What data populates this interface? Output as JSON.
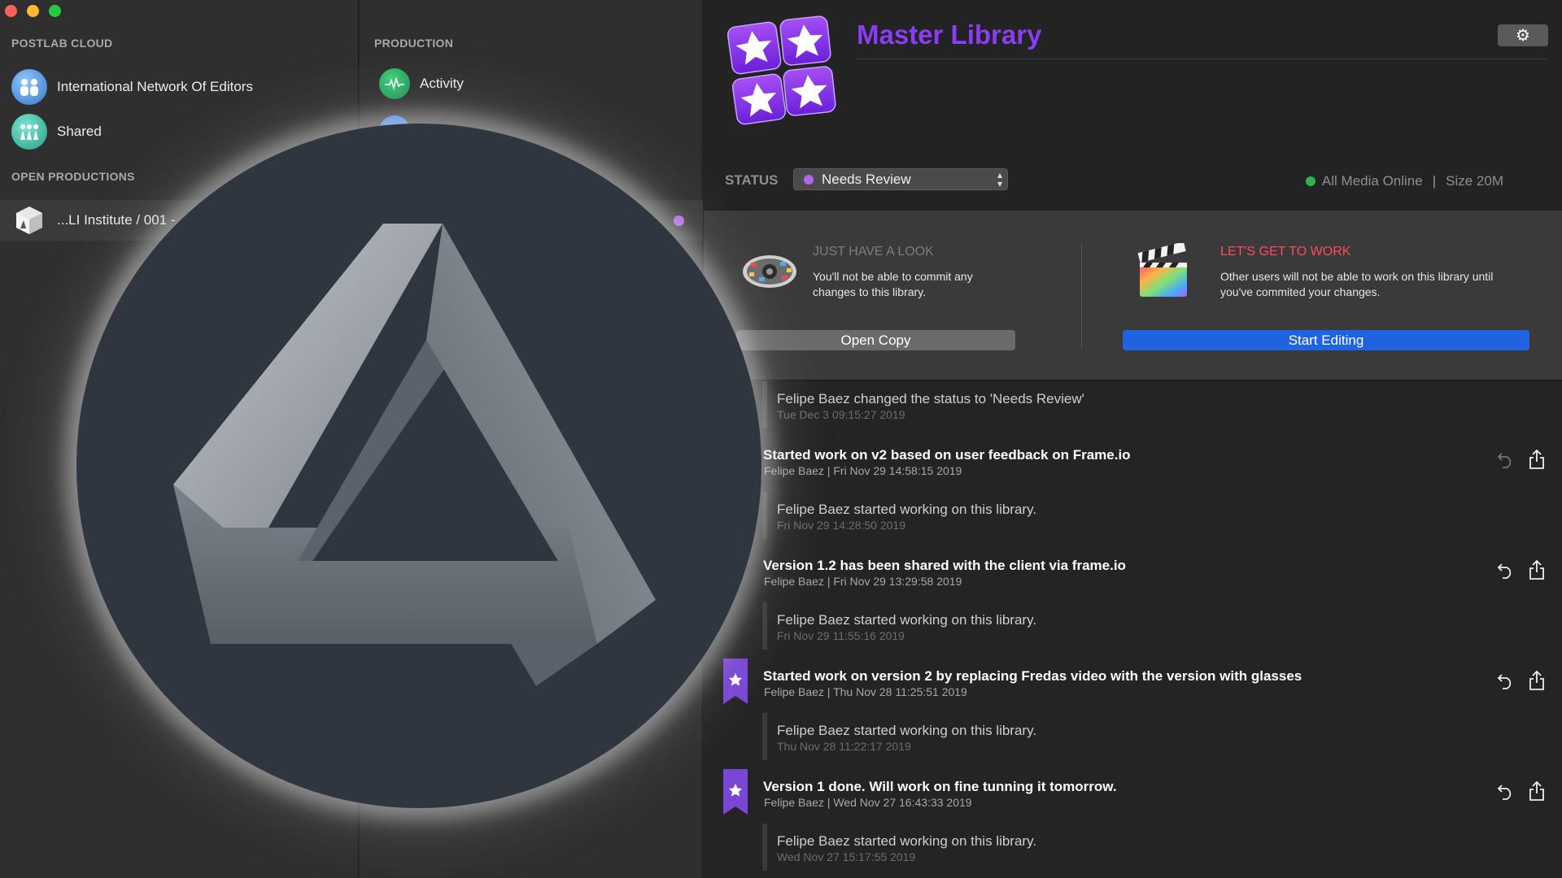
{
  "window": {
    "controls": [
      "close",
      "minimize",
      "zoom"
    ]
  },
  "sidebar": {
    "postlab_cloud_header": "POSTLAB CLOUD",
    "cloud_items": [
      {
        "label": "International Network Of Editors",
        "icon": "team-avatar-icon"
      },
      {
        "label": "Shared",
        "icon": "shared-people-icon"
      }
    ],
    "open_productions_header": "OPEN PRODUCTIONS",
    "open_productions": [
      {
        "label": "...LI Institute / 001 -",
        "icon": "cube-icon"
      }
    ]
  },
  "production": {
    "header": "PRODUCTION",
    "items": [
      {
        "label": "Activity",
        "icon": "activity-pulse-icon"
      }
    ]
  },
  "library": {
    "title": "Master Library",
    "status_label": "STATUS",
    "status_value": "Needs Review",
    "media_status": "All Media Online",
    "size": "Size 20M",
    "accent": "#8a3df2"
  },
  "options": {
    "look": {
      "title": "JUST HAVE A LOOK",
      "desc_line1": "You'll not be able to commit any",
      "desc_line2": "changes to this library.",
      "button": "Open Copy"
    },
    "work": {
      "title": "LET'S GET TO WORK",
      "desc_line1": "Other users will not be able to work on this library until",
      "desc_line2": "you've commited your changes.",
      "button": "Start Editing"
    }
  },
  "feed": {
    "events": [
      {
        "text": "Felipe Baez changed the status to 'Needs Review'",
        "date": "Tue Dec 3 09:15:27 2019"
      },
      {
        "text": "Felipe Baez started working on this library.",
        "date": "Fri Nov 29 14:28:50 2019"
      },
      {
        "text": "Felipe Baez started working on this library.",
        "date": "Fri Nov 29 11:55:16 2019"
      },
      {
        "text": "Felipe Baez started working on this library.",
        "date": "Thu Nov 28 11:22:17 2019"
      },
      {
        "text": "Felipe Baez started working on this library.",
        "date": "Wed Nov 27 15:17:55 2019"
      }
    ],
    "commits": [
      {
        "title": "Started work on v2 based on user feedback on Frame.io",
        "meta": "Felipe Baez | Fri Nov 29 14:58:15 2019",
        "starred": false
      },
      {
        "title": "Version 1.2 has been shared with the client via frame.io",
        "meta": "Felipe Baez | Fri Nov 29 13:29:58 2019",
        "starred": false
      },
      {
        "title": "Started work on version 2 by replacing Fredas video with the version with glasses",
        "meta": "Felipe Baez | Thu Nov 28 11:25:51 2019",
        "starred": true
      },
      {
        "title": "Version 1 done. Will work on fine tunning it tomorrow.",
        "meta": "Felipe Baez | Wed Nov 27 16:43:33 2019",
        "starred": true
      }
    ]
  }
}
